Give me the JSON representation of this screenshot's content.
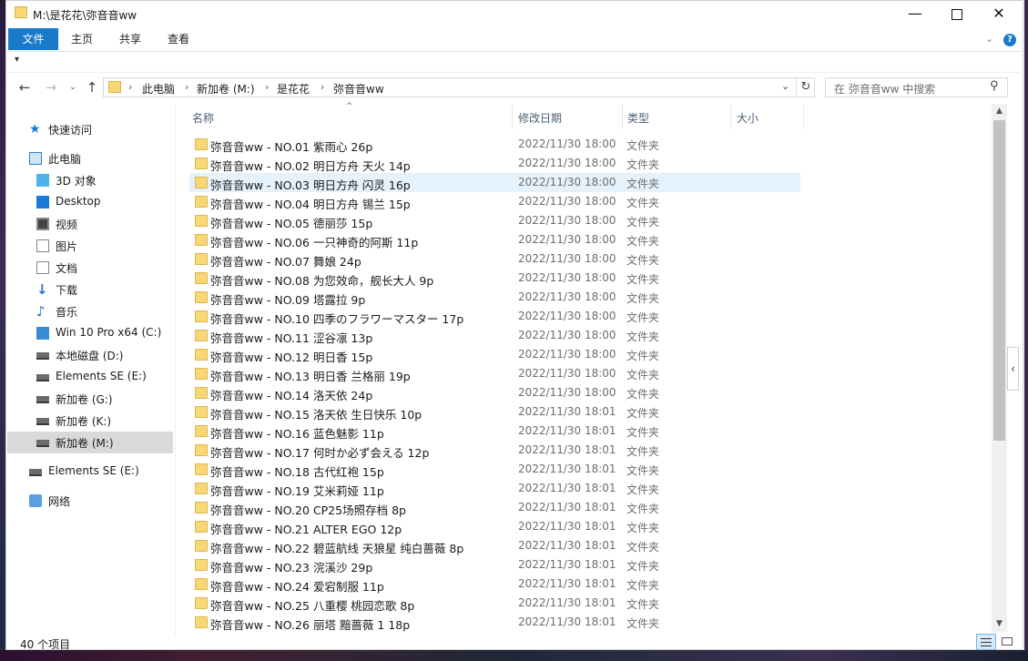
{
  "window": {
    "title": "M:\\是花花\\弥音音ww"
  },
  "ribbon": {
    "tabs": [
      "文件",
      "主页",
      "共享",
      "查看"
    ]
  },
  "address": {
    "breadcrumbs": [
      "此电脑",
      "新加卷 (M:)",
      "是花花",
      "弥音音ww"
    ]
  },
  "search": {
    "placeholder": "在 弥音音ww 中搜索"
  },
  "nav_pane": {
    "items": [
      {
        "label": "快速访问",
        "icon": "star-icon"
      },
      {
        "label": "此电脑",
        "icon": "pc-icon"
      },
      {
        "label": "3D 对象",
        "icon": "3d-objects-icon"
      },
      {
        "label": "Desktop",
        "icon": "desktop-icon"
      },
      {
        "label": "视频",
        "icon": "video-icon"
      },
      {
        "label": "图片",
        "icon": "pictures-icon"
      },
      {
        "label": "文档",
        "icon": "documents-icon"
      },
      {
        "label": "下载",
        "icon": "download-icon"
      },
      {
        "label": "音乐",
        "icon": "music-icon"
      },
      {
        "label": "Win 10 Pro x64 (C:)",
        "icon": "windows-drive-icon"
      },
      {
        "label": "本地磁盘 (D:)",
        "icon": "drive-icon"
      },
      {
        "label": "Elements SE (E:)",
        "icon": "drive-icon"
      },
      {
        "label": "新加卷 (G:)",
        "icon": "drive-icon"
      },
      {
        "label": "新加卷 (K:)",
        "icon": "drive-icon"
      },
      {
        "label": "新加卷 (M:)",
        "icon": "drive-icon",
        "selected": true
      },
      {
        "label": "Elements SE (E:)",
        "icon": "drive-icon"
      },
      {
        "label": "网络",
        "icon": "network-icon"
      }
    ]
  },
  "columns": {
    "name": "名称",
    "date": "修改日期",
    "type": "类型",
    "size": "大小"
  },
  "files": [
    {
      "name": "弥音音ww - NO.01 紫雨心 26p",
      "date": "2022/11/30 18:00",
      "type": "文件夹"
    },
    {
      "name": "弥音音ww - NO.02 明日方舟 天火 14p",
      "date": "2022/11/30 18:00",
      "type": "文件夹"
    },
    {
      "name": "弥音音ww - NO.03 明日方舟 闪灵 16p",
      "date": "2022/11/30 18:00",
      "type": "文件夹"
    },
    {
      "name": "弥音音ww - NO.04 明日方舟 锡兰 15p",
      "date": "2022/11/30 18:00",
      "type": "文件夹"
    },
    {
      "name": "弥音音ww - NO.05 德丽莎 15p",
      "date": "2022/11/30 18:00",
      "type": "文件夹"
    },
    {
      "name": "弥音音ww - NO.06 一只神奇的阿斯 11p",
      "date": "2022/11/30 18:00",
      "type": "文件夹"
    },
    {
      "name": "弥音音ww - NO.07 舞娘 24p",
      "date": "2022/11/30 18:00",
      "type": "文件夹"
    },
    {
      "name": "弥音音ww - NO.08 为您效命，舰长大人 9p",
      "date": "2022/11/30 18:00",
      "type": "文件夹"
    },
    {
      "name": "弥音音ww - NO.09 塔露拉 9p",
      "date": "2022/11/30 18:00",
      "type": "文件夹"
    },
    {
      "name": "弥音音ww - NO.10 四季のフラワーマスター 17p",
      "date": "2022/11/30 18:00",
      "type": "文件夹"
    },
    {
      "name": "弥音音ww - NO.11 涩谷凛 13p",
      "date": "2022/11/30 18:00",
      "type": "文件夹"
    },
    {
      "name": "弥音音ww - NO.12 明日香 15p",
      "date": "2022/11/30 18:00",
      "type": "文件夹"
    },
    {
      "name": "弥音音ww - NO.13 明日香 兰格丽 19p",
      "date": "2022/11/30 18:00",
      "type": "文件夹"
    },
    {
      "name": "弥音音ww - NO.14 洛天依 24p",
      "date": "2022/11/30 18:00",
      "type": "文件夹"
    },
    {
      "name": "弥音音ww - NO.15 洛天依 生日快乐 10p",
      "date": "2022/11/30 18:01",
      "type": "文件夹"
    },
    {
      "name": "弥音音ww - NO.16 蓝色魅影 11p",
      "date": "2022/11/30 18:01",
      "type": "文件夹"
    },
    {
      "name": "弥音音ww - NO.17 何时か必ず会える 12p",
      "date": "2022/11/30 18:01",
      "type": "文件夹"
    },
    {
      "name": "弥音音ww - NO.18 古代红袍 15p",
      "date": "2022/11/30 18:01",
      "type": "文件夹"
    },
    {
      "name": "弥音音ww - NO.19 艾米莉娅 11p",
      "date": "2022/11/30 18:01",
      "type": "文件夹"
    },
    {
      "name": "弥音音ww - NO.20 CP25场照存档 8p",
      "date": "2022/11/30 18:01",
      "type": "文件夹"
    },
    {
      "name": "弥音音ww - NO.21 ALTER EGO 12p",
      "date": "2022/11/30 18:01",
      "type": "文件夹"
    },
    {
      "name": "弥音音ww - NO.22 碧蓝航线 天狼星 纯白蔷薇 8p",
      "date": "2022/11/30 18:01",
      "type": "文件夹"
    },
    {
      "name": "弥音音ww - NO.23 浣溪沙 29p",
      "date": "2022/11/30 18:01",
      "type": "文件夹"
    },
    {
      "name": "弥音音ww - NO.24 爱宕制服 11p",
      "date": "2022/11/30 18:01",
      "type": "文件夹"
    },
    {
      "name": "弥音音ww - NO.25 八重樱 桃园恋歌 8p",
      "date": "2022/11/30 18:01",
      "type": "文件夹"
    },
    {
      "name": "弥音音ww - NO.26 丽塔 黯蔷薇 1 18p",
      "date": "2022/11/30 18:01",
      "type": "文件夹"
    }
  ],
  "status": {
    "count": "40 个项目"
  }
}
